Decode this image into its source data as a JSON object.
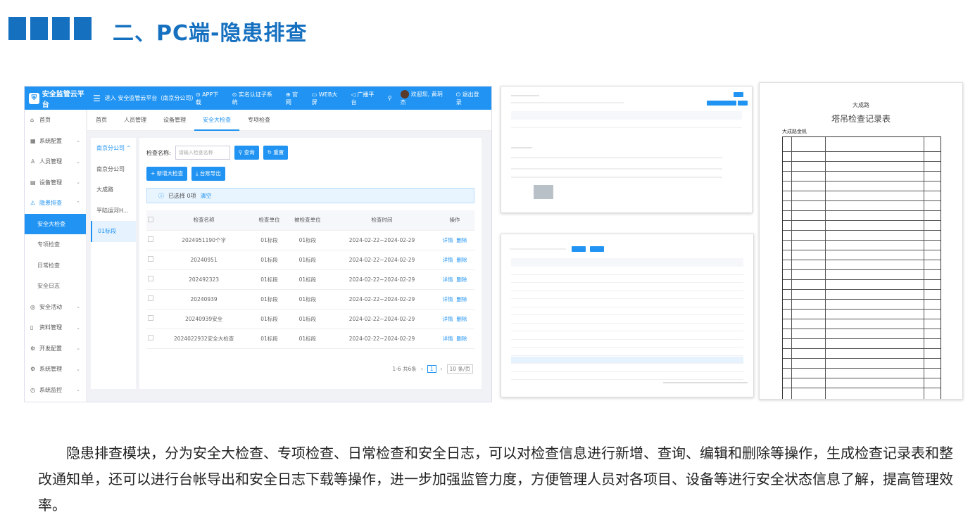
{
  "header": {
    "title": "二、PC端-隐患排查"
  },
  "app": {
    "logo": "安全监管云平台",
    "enter": "进入 安全监管云平台（南京分公司）",
    "top_links": [
      "APP下载",
      "实名认证子系统",
      "官网",
      "WEB大屏",
      "广播平台"
    ],
    "search_icon": "search-icon",
    "welcome": "欢迎您, 黄玥杰",
    "logout": "退出登录",
    "sidebar": [
      {
        "label": "首页",
        "icon": "home-icon"
      },
      {
        "label": "系统配置",
        "icon": "grid-icon"
      },
      {
        "label": "人员管理",
        "icon": "user-icon"
      },
      {
        "label": "设备管理",
        "icon": "device-icon"
      },
      {
        "label": "隐患排查",
        "icon": "hazard-icon"
      },
      {
        "label": "安全活动",
        "icon": "target-icon"
      },
      {
        "label": "资料管理",
        "icon": "file-icon"
      },
      {
        "label": "开发配置",
        "icon": "gear-icon"
      },
      {
        "label": "系统管理",
        "icon": "settings-icon"
      },
      {
        "label": "系统监控",
        "icon": "monitor-icon"
      }
    ],
    "sidebar_sub": [
      "安全大检查",
      "专项检查",
      "日常检查",
      "安全日志"
    ],
    "tabs": [
      "首页",
      "人员管理",
      "设备管理",
      "安全大检查",
      "专项检查"
    ],
    "org_tree": [
      "南京分公司",
      "南京分公司",
      "大成路",
      "平陆运河H...",
      "01标段"
    ],
    "search_label": "检查名称:",
    "search_placeholder": "请输入检查名称",
    "query_btn": "查询",
    "reset_btn": "重置",
    "add_btn": "新增大检查",
    "export_btn": "台账导出",
    "selected_text": "已选择 0项",
    "clear_text": "清空",
    "columns": [
      "检查名称",
      "检查单位",
      "被检查单位",
      "检查时间",
      "操作"
    ],
    "rows": [
      [
        "2024951190个字",
        "01标段",
        "01标段",
        "2024-02-22~2024-02-29"
      ],
      [
        "20240951",
        "01标段",
        "01标段",
        "2024-02-22~2024-02-29"
      ],
      [
        "20249232​3",
        "01标段",
        "01标段",
        "2024-02-22~2024-02-29"
      ],
      [
        "20240939",
        "01标段",
        "01标段",
        "2024-02-22~2024-02-29"
      ],
      [
        "20240939安全",
        "01标段",
        "01标段",
        "2024-02-22~2024-02-29"
      ],
      [
        "2024022932安全大检查",
        "01标段",
        "01标段",
        "2024-02-22~2024-02-29"
      ]
    ],
    "op_detail": "详情",
    "op_delete": "删除",
    "pager_total": "1-6 共6条",
    "pager_page": "1",
    "pager_size": "10 条/页"
  },
  "doc": {
    "company": "大成路",
    "title": "塔吊检查记录表",
    "subtitle": "大成路金帆"
  },
  "paragraph": "隐患排查模块，分为安全大检查、专项检查、日常检查和安全日志，可以对检查信息进行新增、查询、编辑和删除等操作，生成检查记录表和整改通知单，还可以进行台帐导出和安全日志下载等操作，进一步加强监管力度，方便管理人员对各项目、设备等进行安全状态信息了解，提高管理效率。"
}
